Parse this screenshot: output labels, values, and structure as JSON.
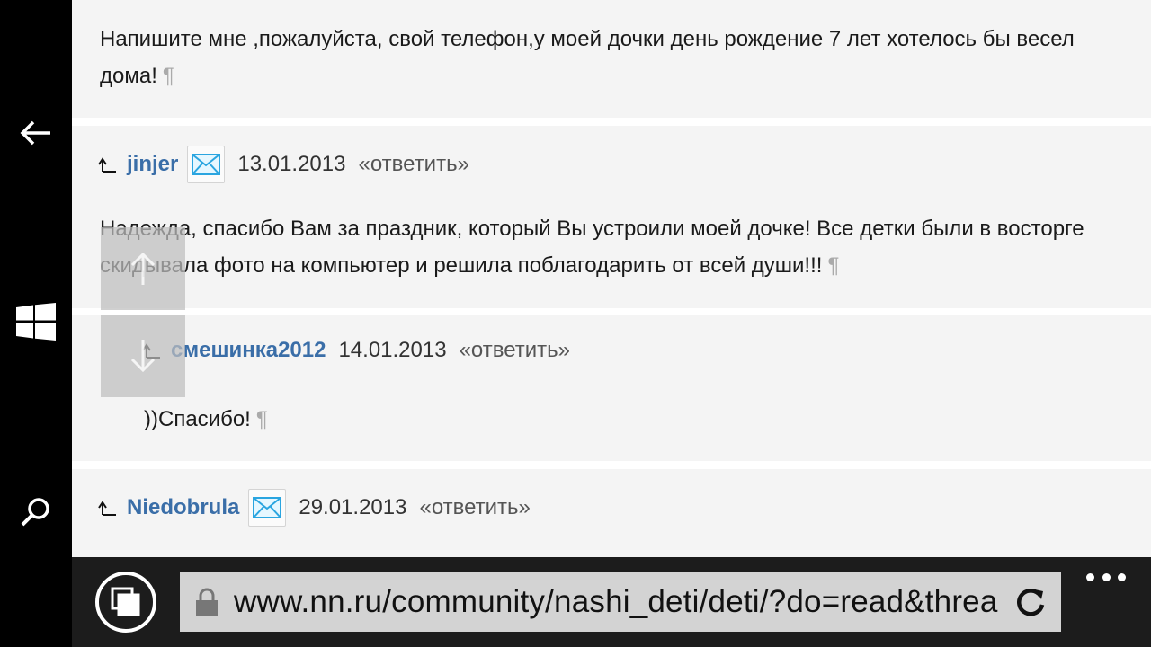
{
  "posts": [
    {
      "text_lines": [
        "Напишите мне ,пожалуйста, свой телефон,у моей дочки день рождение 7 лет хотелось бы весел",
        "дома!"
      ],
      "pilcrow": "¶"
    },
    {
      "author": "jinjer",
      "date": "13.01.2013",
      "reply": "«ответить»",
      "text_lines": [
        "Надежда, спасибо Вам за праздник, который Вы устроили моей дочке! Все детки были в восторге",
        "скидывала фото на компьютер и решила поблагодарить от всей души!!!"
      ],
      "pilcrow": "¶"
    },
    {
      "author": "смешинка2012",
      "date": "14.01.2013",
      "reply": "«ответить»",
      "text_lines": [
        "))Спасибо!"
      ],
      "pilcrow": "¶"
    },
    {
      "author": "Niedobrula",
      "date": "29.01.2013",
      "reply": "«ответить»"
    }
  ],
  "browser": {
    "url": "www.nn.ru/community/nashi_deti/deti/?do=read&threa"
  },
  "icons": {
    "back": "back-arrow-icon",
    "home": "windows-logo-icon",
    "search": "search-icon",
    "reply": "reply-arrow-icon",
    "mail": "mail-icon",
    "lock": "lock-icon",
    "refresh": "refresh-icon",
    "tabs": "tabs-icon",
    "more": "more-icon",
    "scroll_up": "scroll-up-icon",
    "scroll_down": "scroll-down-icon"
  },
  "colors": {
    "author": "#3a6ea8",
    "post_bg": "#f4f4f4",
    "address_bg": "#d3d3d3"
  }
}
